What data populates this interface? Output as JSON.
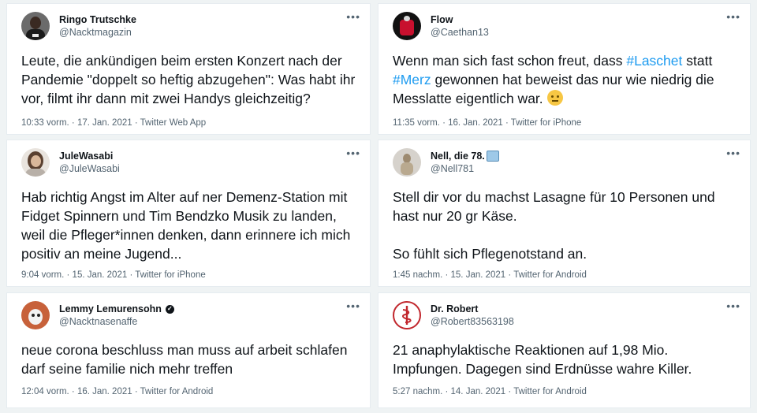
{
  "tweets": [
    {
      "name": "Ringo Trutschke",
      "handle": "@Nacktmagazin",
      "text": "Leute, die ankündigen beim ersten Konzert nach der Pandemie \"doppelt so heftig abzugehen\": Was habt ihr vor, filmt ihr dann mit zwei Handys gleichzeitig?",
      "meta": "10:33 vorm. · 17. Jan. 2021 · Twitter Web App"
    },
    {
      "name": "Flow",
      "handle": "@Caethan13",
      "text_parts": [
        "Wenn man sich fast schon freut, dass ",
        "#Laschet",
        " statt",
        "#Merz",
        " gewonnen hat beweist das nur wie niedrig die Messlatte eigentlich war. "
      ],
      "meta": "11:35 vorm. · 16. Jan. 2021 · Twitter for iPhone"
    },
    {
      "name": "JuleWasabi",
      "handle": "@JuleWasabi",
      "text": "Hab richtig Angst im Alter auf ner Demenz-Station mit Fidget Spinnern und Tim Bendzko Musik zu landen, weil die Pfleger*innen denken, dann erinnere ich mich positiv an meine Jugend...",
      "meta": "9:04 vorm. · 15. Jan. 2021 · Twitter for iPhone"
    },
    {
      "name": "Nell, die 78.",
      "handle": "@Nell781",
      "text": "Stell dir vor du machst Lasagne für 10 Personen und hast nur 20 gr Käse.\n\nSo fühlt sich Pflegenotstand an.",
      "meta": "1:45 nachm. · 15. Jan. 2021 · Twitter for Android"
    },
    {
      "name": "Lemmy Lemurensohn",
      "handle": "@Nacktnasenaffe",
      "text": "neue corona beschluss man muss auf arbeit schlafen darf seine familie nich mehr treffen",
      "meta": "12:04 vorm. · 16. Jan. 2021 · Twitter for Android"
    },
    {
      "name": "Dr. Robert",
      "handle": "@Robert83563198",
      "text": "21 anaphylaktische Reaktionen auf 1,98 Mio. Impfungen. Dagegen sind Erdnüsse wahre Killer.",
      "meta": "5:27 nachm. · 14. Jan. 2021 · Twitter for Android"
    }
  ],
  "more_label": "•••",
  "colors": {
    "hashtag": "#1d9bf0",
    "secondary": "#536471",
    "background": "#eff3f4"
  }
}
